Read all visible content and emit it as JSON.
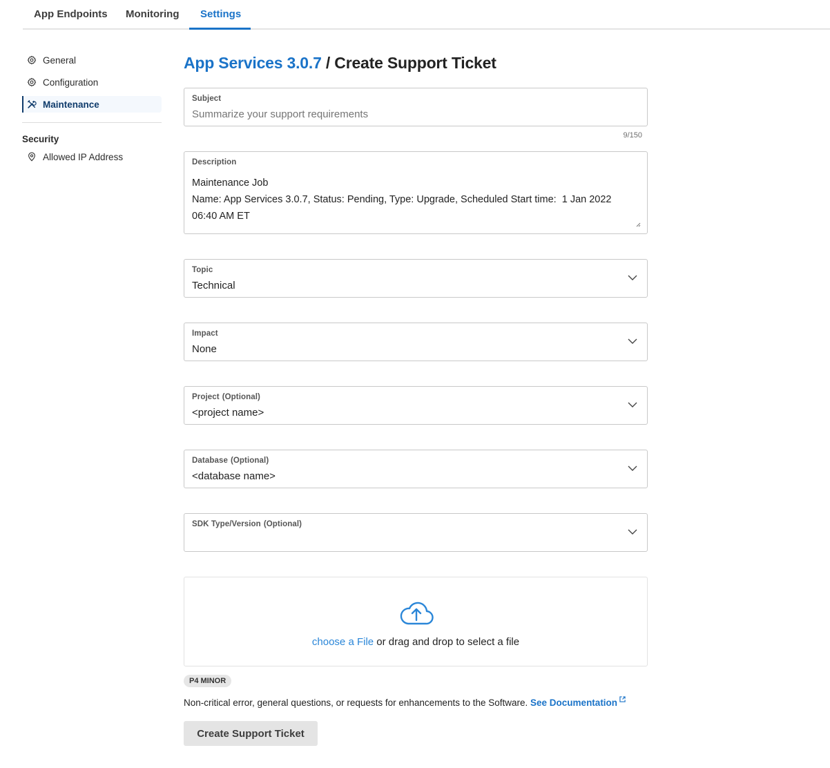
{
  "tabs": [
    {
      "label": "App Endpoints",
      "active": false
    },
    {
      "label": "Monitoring",
      "active": false
    },
    {
      "label": "Settings",
      "active": true
    }
  ],
  "sidebar": {
    "items": [
      {
        "label": "General",
        "icon": "gear-icon",
        "active": false
      },
      {
        "label": "Configuration",
        "icon": "gear-icon",
        "active": false
      },
      {
        "label": "Maintenance",
        "icon": "tools-icon",
        "active": true
      }
    ],
    "security_heading": "Security",
    "security_items": [
      {
        "label": "Allowed IP Address",
        "icon": "location-pin-icon"
      }
    ]
  },
  "page": {
    "breadcrumb_link": "App Services 3.0.7",
    "separator": "/",
    "title": "Create Support Ticket"
  },
  "form": {
    "subject": {
      "label": "Subject",
      "value": "",
      "placeholder": "Summarize your support requirements",
      "counter": "9/150"
    },
    "description": {
      "label": "Description",
      "value": "Maintenance Job\nName: App Services 3.0.7, Status: Pending, Type: Upgrade, Scheduled Start time:  1 Jan 2022\n06:40 AM ET"
    },
    "topic": {
      "label": "Topic",
      "value": "Technical"
    },
    "impact": {
      "label": "Impact",
      "value": "None"
    },
    "project": {
      "label": "Project",
      "optional": "(Optional)",
      "value": "<project name>"
    },
    "database": {
      "label": "Database",
      "optional": "(Optional)",
      "value": "<database name>"
    },
    "sdk": {
      "label": "SDK Type/Version",
      "optional": "(Optional)",
      "value": ""
    },
    "upload": {
      "link": "choose a File",
      "text": " or drag and drop to select a file"
    },
    "priority_badge": "P4 MINOR",
    "priority_note": "Non-critical error, general questions, or requests for enhancements to the Software.",
    "doc_link": "See Documentation",
    "submit_label": "Create Support Ticket"
  },
  "colors": {
    "accent": "#1a73c8",
    "active_nav": "#0f3b6b",
    "upload_link": "#2a86d8",
    "button_bg": "#e4e4e4"
  }
}
